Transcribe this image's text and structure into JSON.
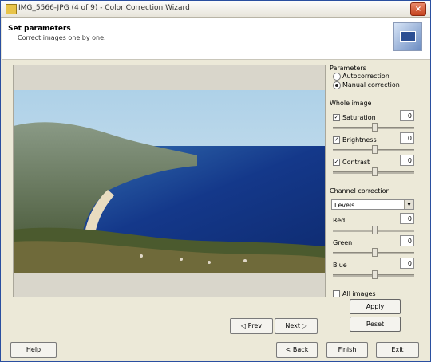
{
  "window": {
    "title": "IMG_5566-JPG (4 of 9) - Color Correction Wizard",
    "close": "×"
  },
  "header": {
    "title": "Set parameters",
    "subtitle": "Correct images one by one."
  },
  "preview": {
    "image": "coastal-bay-photo",
    "prev_label": "◁ Prev",
    "next_label": "Next ▷"
  },
  "side": {
    "parameters_label": "Parameters",
    "auto_correction_label": "Autocorrection",
    "manual_correction_label": "Manual correction",
    "mode": "manual",
    "whole_image_label": "Whole image",
    "saturation_label": "Saturation",
    "saturation_value": "0",
    "brightness_label": "Brightness",
    "brightness_value": "0",
    "contrast_label": "Contrast",
    "contrast_value": "0",
    "channel_label": "Channel correction",
    "channel_selected": "Levels",
    "red_label": "Red",
    "red_value": "0",
    "green_label": "Green",
    "green_value": "0",
    "blue_label": "Blue",
    "blue_value": "0",
    "all_images_label": "All images",
    "apply_label": "Apply",
    "reset_label": "Reset"
  },
  "footer": {
    "help_label": "Help",
    "back_label": "< Back",
    "finish_label": "Finish",
    "exit_label": "Exit"
  },
  "colors": {
    "sea": "#1a3f86",
    "sky": "#b8d7ea",
    "window_bg": "#ece9d8"
  }
}
